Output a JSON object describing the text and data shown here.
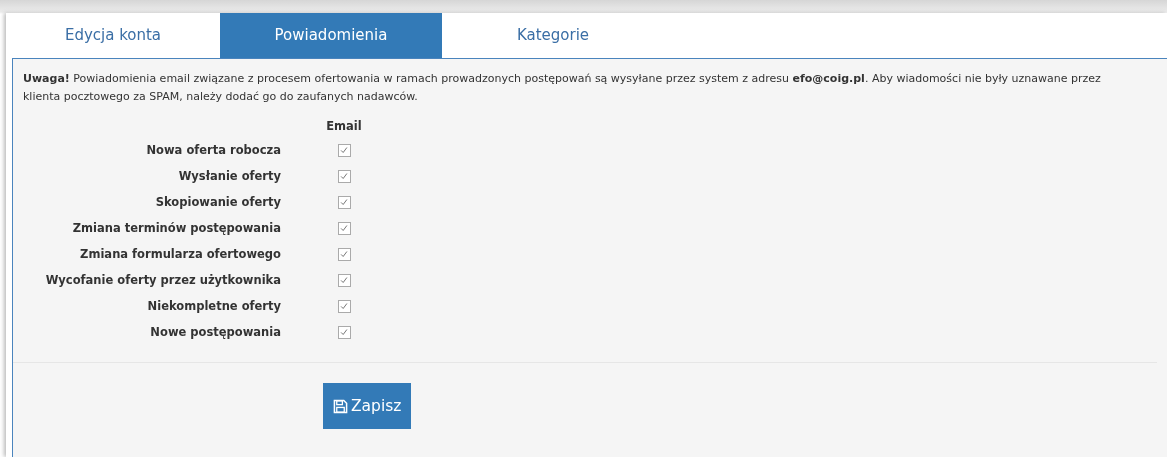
{
  "tabs": [
    {
      "label": "Edycja konta",
      "selected": false
    },
    {
      "label": "Powiadomienia",
      "selected": true
    },
    {
      "label": "Kategorie",
      "selected": false
    }
  ],
  "notice": "**Uwaga!** Powiadomienia email związane z procesem ofertowania w ramach prowadzonych postępowań są wysyłane przez system z adresu **efo@coig.pl**. Aby wiadomości nie były uznawane przez klienta pocztowego za SPAM, należy dodać go do zaufanych nadawców.",
  "column_header": "Email",
  "settings": [
    {
      "label": "Nowa oferta robocza",
      "checked": true
    },
    {
      "label": "Wysłanie oferty",
      "checked": true
    },
    {
      "label": "Skopiowanie oferty",
      "checked": true
    },
    {
      "label": "Zmiana terminów postępowania",
      "checked": true
    },
    {
      "label": "Zmiana formularza ofertowego",
      "checked": true
    },
    {
      "label": "Wycofanie oferty przez użytkownika",
      "checked": true
    },
    {
      "label": "Niekompletne oferty",
      "checked": true
    },
    {
      "label": "Nowe postępowania",
      "checked": true
    }
  ],
  "save_button": "Zapisz"
}
